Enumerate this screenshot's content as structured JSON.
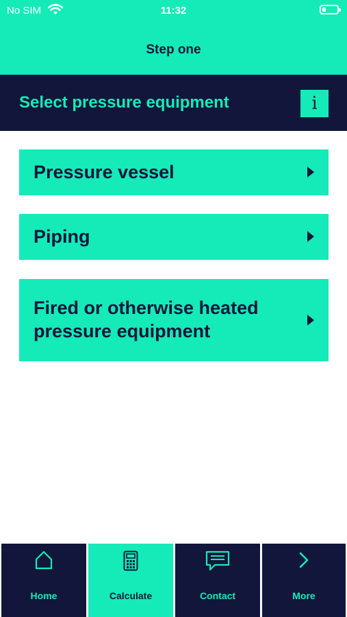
{
  "status_bar": {
    "carrier": "No SIM",
    "time": "11:32"
  },
  "nav": {
    "title": "Step one"
  },
  "header": {
    "title": "Select pressure equipment",
    "info_label": "i"
  },
  "options": [
    {
      "label": "Pressure vessel"
    },
    {
      "label": "Piping"
    },
    {
      "label": "Fired or otherwise heated pressure equipment"
    }
  ],
  "tabbar": {
    "items": [
      {
        "label": "Home",
        "icon": "home-icon",
        "active": false
      },
      {
        "label": "Calculate",
        "icon": "calculator-icon",
        "active": true
      },
      {
        "label": "Contact",
        "icon": "message-icon",
        "active": false
      },
      {
        "label": "More",
        "icon": "chevron-right-icon",
        "active": false
      }
    ]
  },
  "colors": {
    "accent": "#14ebb8",
    "dark": "#12163a",
    "background": "#ffffff"
  }
}
